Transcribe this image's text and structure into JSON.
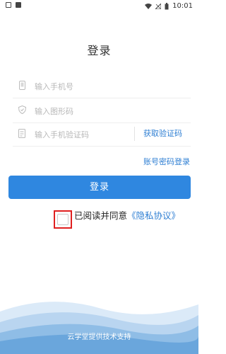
{
  "status": {
    "time": "10:01"
  },
  "page": {
    "title": "登录"
  },
  "form": {
    "phone_placeholder": "输入手机号",
    "captcha_placeholder": "输入图形码",
    "sms_placeholder": "输入手机验证码",
    "get_code_label": "获取验证码",
    "password_login_label": "账号密码登录",
    "login_label": "登录"
  },
  "agreement": {
    "text": "已阅读并同意",
    "link": "《隐私协议》"
  },
  "footer": {
    "text": "云学堂提供技术支持"
  },
  "colors": {
    "accent": "#2f87e0",
    "link": "#2f7fd3",
    "highlight_border": "#e02020"
  }
}
